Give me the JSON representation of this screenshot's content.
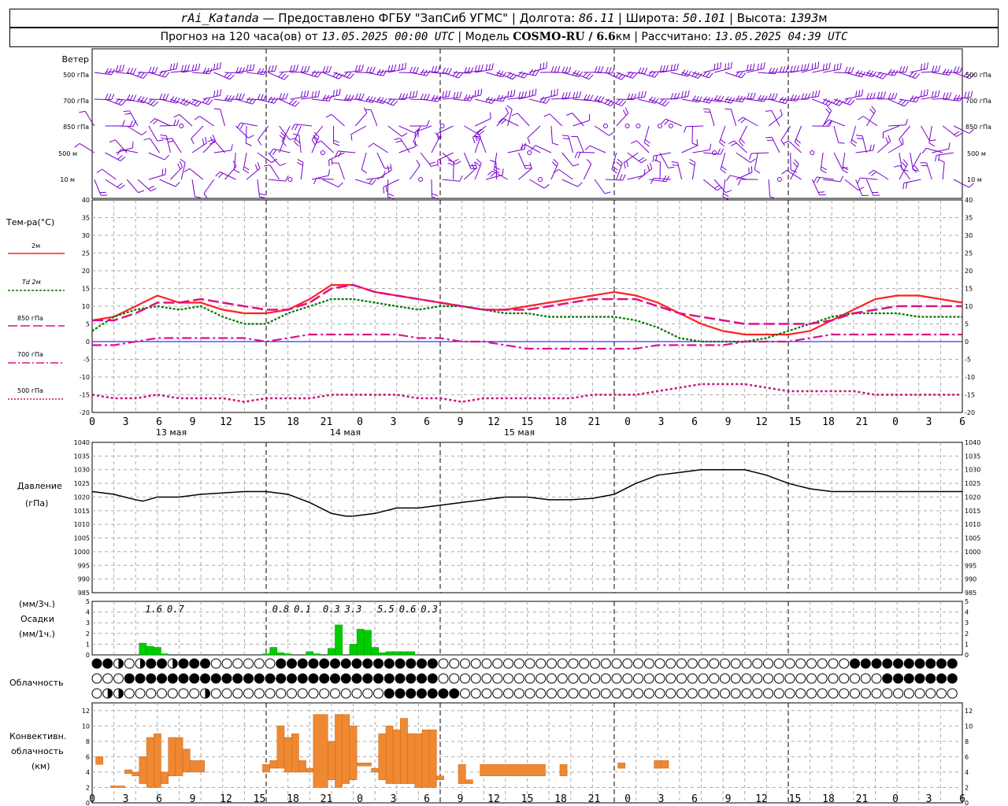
{
  "header": {
    "station": "rAi_Katanda",
    "provider": "— Предоставлено ФГБУ \"ЗапСиб УГМС\"",
    "lon_label": "Долгота:",
    "lon_value": "86.11",
    "lat_label": "Широта:",
    "lat_value": "50.101",
    "alt_label": "Высота:",
    "alt_value": "1393",
    "alt_unit": "м",
    "forecast_label": "Прогноз на 120 часа(ов) от",
    "forecast_start": "13.05.2025 00:00 UTC",
    "model_label": "Модель",
    "model_name": "COSMO-RU / 6.6",
    "model_unit": "км",
    "calc_label": "Рассчитано:",
    "calc_time": "13.05.2025 04:39 UTC"
  },
  "labels": {
    "wind": "Ветер",
    "wind_levels": [
      "500 гПа",
      "700 гПа",
      "850 гПа",
      "500 м",
      "10 м"
    ],
    "temp": "Тем-ра(°С)",
    "temp_legend": [
      "2м",
      "Td 2м",
      "850 гПа",
      "700 гПа",
      "500 гПа"
    ],
    "pressure": "Давление",
    "pressure_unit": "(гПа)",
    "precip_unit3": "(мм/3ч.)",
    "precip": "Осадки",
    "precip_unit1": "(мм/1ч.)",
    "cloud": "Облачность",
    "conv1": "Конвективн.",
    "conv2": "облачность",
    "conv3": "(км)"
  },
  "colors": {
    "t2m": "#ff2222",
    "td2m": "#007700",
    "t850": "#dd1188",
    "t700": "#dd1188",
    "t500": "#cc1177",
    "wind": "#7700cc",
    "pressure": "#000000",
    "precip": "#00cc00",
    "convective": "#ee8833",
    "zero_line": "#0000ff"
  },
  "chart_data": [
    {
      "type": "line",
      "name": "temperature",
      "x": [
        0,
        3,
        6,
        9,
        12,
        15,
        18,
        21,
        24,
        27,
        30,
        33,
        36,
        39,
        42,
        45,
        48,
        51,
        54,
        57,
        60,
        63,
        66,
        69,
        72,
        75,
        78,
        81,
        84,
        87,
        90,
        93,
        96,
        99,
        102,
        105,
        108,
        111,
        114,
        117,
        120
      ],
      "ylim": [
        -20,
        40
      ],
      "yticks": [
        -20,
        -15,
        -10,
        -5,
        0,
        5,
        10,
        15,
        20,
        25,
        30,
        35,
        40
      ],
      "series": [
        {
          "name": "2м",
          "values": [
            6,
            7,
            10,
            13,
            11,
            11,
            9,
            8,
            8,
            9,
            12,
            16,
            16,
            14,
            13,
            12,
            11,
            10,
            9,
            9,
            10,
            11,
            12,
            13,
            14,
            13,
            11,
            8,
            5,
            3,
            2,
            2,
            2,
            3,
            6,
            9,
            12,
            13,
            13,
            12,
            11
          ]
        },
        {
          "name": "Td 2м",
          "values": [
            3,
            7,
            9,
            10,
            9,
            10,
            7,
            5,
            5,
            8,
            10,
            12,
            12,
            11,
            10,
            9,
            10,
            10,
            9,
            8,
            8,
            7,
            7,
            7,
            7,
            6,
            4,
            1,
            0,
            0,
            0,
            1,
            3,
            5,
            7,
            8,
            8,
            8,
            7,
            7,
            7
          ]
        },
        {
          "name": "850 гПа",
          "values": [
            6,
            6,
            8,
            11,
            11,
            12,
            11,
            10,
            9,
            9,
            11,
            15,
            16,
            14,
            13,
            12,
            11,
            10,
            9,
            9,
            9,
            10,
            11,
            12,
            12,
            12,
            10,
            8,
            7,
            6,
            5,
            5,
            5,
            5,
            6,
            8,
            9,
            10,
            10,
            10,
            10
          ]
        },
        {
          "name": "700 гПа",
          "values": [
            -1,
            -1,
            0,
            1,
            1,
            1,
            1,
            1,
            0,
            1,
            2,
            2,
            2,
            2,
            2,
            1,
            1,
            0,
            0,
            -1,
            -2,
            -2,
            -2,
            -2,
            -2,
            -2,
            -1,
            -1,
            -1,
            -1,
            0,
            0,
            0,
            1,
            2,
            2,
            2,
            2,
            2,
            2,
            2
          ]
        },
        {
          "name": "500 гПа",
          "values": [
            -15,
            -16,
            -16,
            -15,
            -16,
            -16,
            -16,
            -17,
            -16,
            -16,
            -16,
            -15,
            -15,
            -15,
            -15,
            -16,
            -16,
            -17,
            -16,
            -16,
            -16,
            -16,
            -16,
            -15,
            -15,
            -15,
            -14,
            -13,
            -12,
            -12,
            -12,
            -13,
            -14,
            -14,
            -14,
            -14,
            -15,
            -15,
            -15,
            -15,
            -15
          ]
        }
      ],
      "xticks": [
        "0",
        "3",
        "6",
        "9",
        "12",
        "15",
        "18",
        "21",
        "0",
        "3",
        "6",
        "9",
        "12",
        "15",
        "18",
        "21",
        "0",
        "3",
        "6",
        "9",
        "12",
        "15",
        "18",
        "21",
        "0",
        "3",
        "6"
      ],
      "day_labels": [
        "13 мая",
        "14 мая",
        "15 мая"
      ]
    },
    {
      "type": "line",
      "name": "pressure",
      "x": [
        0,
        3,
        6,
        7,
        9,
        12,
        15,
        18,
        21,
        24,
        27,
        30,
        33,
        35,
        36,
        39,
        42,
        45,
        48,
        51,
        54,
        57,
        60,
        63,
        66,
        69,
        72,
        75,
        78,
        81,
        84,
        87,
        90,
        93,
        96,
        99,
        102,
        105,
        108,
        111,
        114,
        117,
        120
      ],
      "ylim": [
        985,
        1040
      ],
      "yticks": [
        985,
        990,
        995,
        1000,
        1005,
        1010,
        1015,
        1020,
        1025,
        1030,
        1035,
        1040
      ],
      "series": [
        {
          "name": "Давление",
          "values": [
            1022,
            1021,
            1019,
            1018.5,
            1020,
            1020,
            1021,
            1021.5,
            1022,
            1022,
            1021,
            1018,
            1014,
            1013,
            1013,
            1014,
            1016,
            1016,
            1017,
            1018,
            1019,
            1020,
            1020,
            1019,
            1019,
            1019.5,
            1021,
            1025,
            1028,
            1029,
            1030,
            1030,
            1030,
            1028,
            1025,
            1023,
            1022,
            1022,
            1022,
            1022,
            1022,
            1022,
            1022
          ]
        }
      ]
    },
    {
      "type": "bar",
      "name": "precipitation",
      "ylim": [
        0,
        5
      ],
      "yticks": [
        0,
        1,
        2,
        3,
        4,
        5
      ],
      "x_hours": [
        7,
        8,
        9,
        10,
        24,
        25,
        26,
        27,
        30,
        31,
        33,
        34,
        36,
        37,
        38,
        39,
        40,
        41,
        42,
        43,
        44
      ],
      "values": [
        1.1,
        0.8,
        0.7,
        0.1,
        0.1,
        0.7,
        0.2,
        0.1,
        0.3,
        0.1,
        0.6,
        2.8,
        1.0,
        2.4,
        2.3,
        0.7,
        0.2,
        0.3,
        0.3,
        0.3,
        0.3
      ],
      "totals_3h": [
        "1.6",
        "0.7",
        "0.8",
        "0.1",
        "0.3",
        "3.3",
        "5.5",
        "0.6",
        "0.3"
      ],
      "totals_hours": [
        8.5,
        11.5,
        26,
        29,
        33,
        36,
        40.5,
        43.5,
        46.5
      ]
    },
    {
      "type": "bar",
      "name": "convective_cloud",
      "ylim": [
        0,
        13
      ],
      "yticks": [
        0,
        2,
        4,
        6,
        8,
        10,
        12
      ],
      "segments": [
        {
          "h0": 0.5,
          "h1": 1.5,
          "base": 5,
          "top": 6
        },
        {
          "h0": 2.5,
          "h1": 4.5,
          "base": 2,
          "top": 2.2
        },
        {
          "h0": 4.5,
          "h1": 5.5,
          "base": 3.8,
          "top": 4.3
        },
        {
          "h0": 5.5,
          "h1": 6.5,
          "base": 3.5,
          "top": 4
        },
        {
          "h0": 6.5,
          "h1": 7.5,
          "base": 2.5,
          "top": 6
        },
        {
          "h0": 7.5,
          "h1": 8.5,
          "base": 2,
          "top": 8.5
        },
        {
          "h0": 8.5,
          "h1": 9.5,
          "base": 2,
          "top": 9
        },
        {
          "h0": 9.5,
          "h1": 10.5,
          "base": 2.5,
          "top": 4
        },
        {
          "h0": 10.5,
          "h1": 11.5,
          "base": 3.5,
          "top": 8.5
        },
        {
          "h0": 11.5,
          "h1": 12.5,
          "base": 3.5,
          "top": 8.5
        },
        {
          "h0": 12.5,
          "h1": 13.5,
          "base": 4,
          "top": 7
        },
        {
          "h0": 13.5,
          "h1": 15.5,
          "base": 4,
          "top": 5.5
        },
        {
          "h0": 23.5,
          "h1": 24.5,
          "base": 4,
          "top": 5
        },
        {
          "h0": 24.5,
          "h1": 25.5,
          "base": 4.5,
          "top": 5.5
        },
        {
          "h0": 25.5,
          "h1": 26.5,
          "base": 4.5,
          "top": 10
        },
        {
          "h0": 26.5,
          "h1": 27.5,
          "base": 4,
          "top": 8.5
        },
        {
          "h0": 27.5,
          "h1": 28.5,
          "base": 4,
          "top": 9
        },
        {
          "h0": 28.5,
          "h1": 29.5,
          "base": 4,
          "top": 5.5
        },
        {
          "h0": 29.5,
          "h1": 30.5,
          "base": 4,
          "top": 4.5
        },
        {
          "h0": 30.5,
          "h1": 32.5,
          "base": 2,
          "top": 11.5
        },
        {
          "h0": 32.5,
          "h1": 33.5,
          "base": 3,
          "top": 8
        },
        {
          "h0": 33.5,
          "h1": 34.5,
          "base": 2,
          "top": 11.5
        },
        {
          "h0": 34.5,
          "h1": 35.5,
          "base": 2.5,
          "top": 11.5
        },
        {
          "h0": 35.5,
          "h1": 36.5,
          "base": 3,
          "top": 10
        },
        {
          "h0": 36.5,
          "h1": 38.5,
          "base": 4.8,
          "top": 5.2
        },
        {
          "h0": 38.5,
          "h1": 39.5,
          "base": 4,
          "top": 4.5
        },
        {
          "h0": 39.5,
          "h1": 40.5,
          "base": 3,
          "top": 9
        },
        {
          "h0": 40.5,
          "h1": 41.5,
          "base": 2.5,
          "top": 10
        },
        {
          "h0": 41.5,
          "h1": 42.5,
          "base": 2.5,
          "top": 9.5
        },
        {
          "h0": 42.5,
          "h1": 43.5,
          "base": 2.5,
          "top": 11
        },
        {
          "h0": 43.5,
          "h1": 44.5,
          "base": 2.5,
          "top": 9
        },
        {
          "h0": 44.5,
          "h1": 45.5,
          "base": 2,
          "top": 9
        },
        {
          "h0": 45.5,
          "h1": 46.5,
          "base": 2,
          "top": 9.5
        },
        {
          "h0": 46.5,
          "h1": 47.5,
          "base": 2,
          "top": 9.5
        },
        {
          "h0": 47.5,
          "h1": 48.5,
          "base": 3,
          "top": 3.5
        },
        {
          "h0": 50.5,
          "h1": 51.5,
          "base": 2.5,
          "top": 5
        },
        {
          "h0": 51.5,
          "h1": 52.5,
          "base": 2.5,
          "top": 3
        },
        {
          "h0": 53.5,
          "h1": 62.5,
          "base": 3.5,
          "top": 5
        },
        {
          "h0": 64.5,
          "h1": 65.5,
          "base": 3.5,
          "top": 5
        },
        {
          "h0": 72.5,
          "h1": 73.5,
          "base": 4.5,
          "top": 5.2
        },
        {
          "h0": 77.5,
          "h1": 78.5,
          "base": 4.5,
          "top": 5.5
        },
        {
          "h0": 78.5,
          "h1": 79.5,
          "base": 4.5,
          "top": 5.5
        }
      ]
    }
  ]
}
